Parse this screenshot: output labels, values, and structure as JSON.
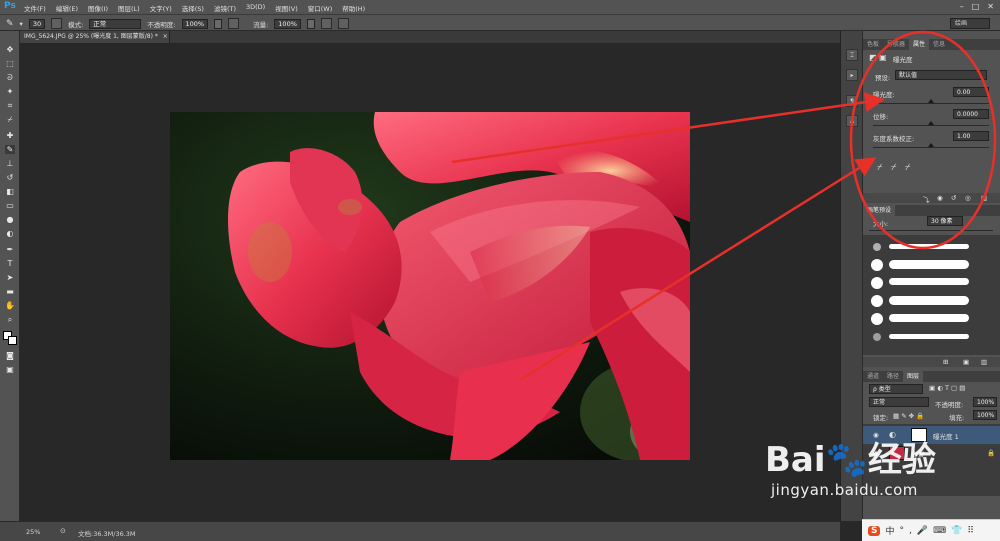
{
  "app": {
    "logo": "Ps",
    "menus": [
      "文件(F)",
      "编辑(E)",
      "图像(I)",
      "图层(L)",
      "文字(Y)",
      "选择(S)",
      "滤镜(T)",
      "3D(D)",
      "视图(V)",
      "窗口(W)",
      "帮助(H)"
    ],
    "window_controls": [
      "–",
      "□",
      "✕"
    ],
    "workspace": "绘画"
  },
  "options_bar": {
    "brush_size": "30",
    "mode_label": "模式:",
    "mode_value": "正常",
    "opacity_label": "不透明度:",
    "opacity_value": "100%",
    "flow_label": "流量:",
    "flow_value": "100%"
  },
  "document": {
    "tab_title": "IMG_5624.JPG @ 25% (曝光度 1, 图层蒙版/8) *",
    "close": "×"
  },
  "status": {
    "zoom": "25%",
    "doc_info": "文档:36.3M/36.3M"
  },
  "properties_panel": {
    "tabs": [
      "色板",
      "导航器",
      "属性",
      "信息"
    ],
    "active_tab": "属性",
    "title": "曝光度",
    "preset_label": "预设:",
    "preset_value": "默认值",
    "exposure_label": "曝光度:",
    "exposure_value": "0.00",
    "offset_label": "位移:",
    "offset_value": "0.0000",
    "gamma_label": "灰度系数校正:",
    "gamma_value": "1.00",
    "exposure_pos": 0.5,
    "offset_pos": 0.5,
    "gamma_pos": 0.5
  },
  "brush_panel": {
    "tab": "画笔预设",
    "size_label": "大小:",
    "size_value": "30 像素"
  },
  "layers_panel": {
    "tabs": [
      "通道",
      "路径",
      "图层"
    ],
    "active_tab": "图层",
    "filter_label": "ρ 类型",
    "blend_mode": "正常",
    "opacity_label": "不透明度:",
    "opacity_value": "100%",
    "lock_label": "锁定:",
    "fill_label": "填充:",
    "fill_value": "100%",
    "layers": [
      {
        "name": "曝光度 1"
      },
      {
        "name": "背景"
      }
    ]
  },
  "ime_bar": {
    "logo": "S",
    "items": [
      "中",
      "°",
      ",",
      "🎤",
      "⌨",
      "👕",
      "⠿"
    ]
  },
  "watermark": {
    "brand": "Bai",
    "brand2": "经验",
    "url": "jingyan.baidu.com"
  },
  "colors": {
    "accent_blue": "#2fa3e8",
    "annotation_red": "#e8302a",
    "panel_bg": "#535353",
    "canvas_bg": "#282828"
  }
}
